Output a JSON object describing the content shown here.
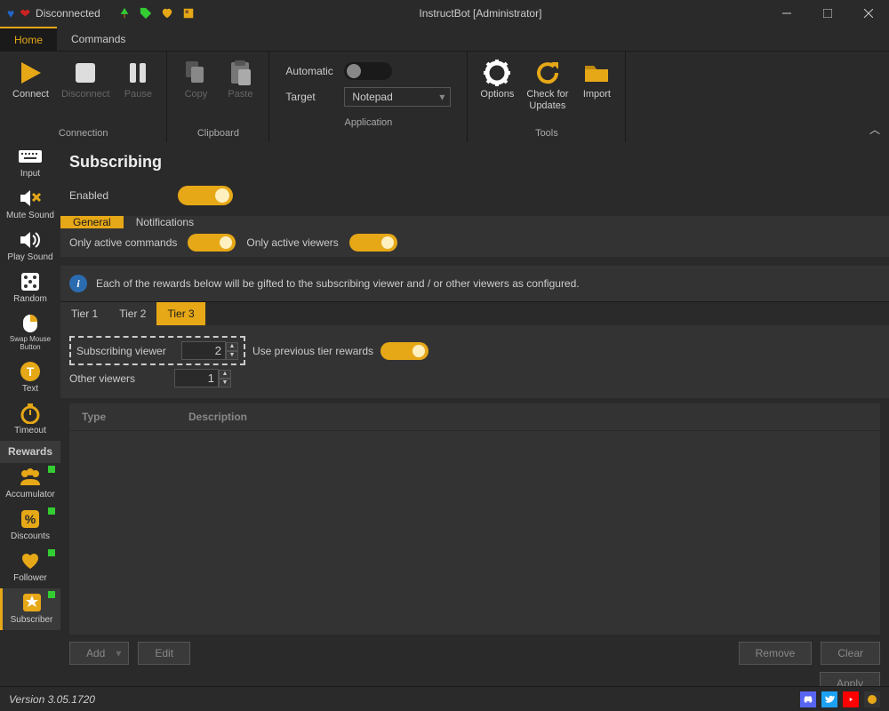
{
  "window": {
    "title": "InstructBot [Administrator]",
    "connection_status": "Disconnected"
  },
  "menu": {
    "home": "Home",
    "commands": "Commands"
  },
  "ribbon": {
    "connection": {
      "label": "Connection",
      "connect": "Connect",
      "disconnect": "Disconnect",
      "pause": "Pause"
    },
    "clipboard": {
      "label": "Clipboard",
      "copy": "Copy",
      "paste": "Paste"
    },
    "application": {
      "label": "Application",
      "automatic": "Automatic",
      "target": "Target",
      "target_value": "Notepad"
    },
    "tools": {
      "label": "Tools",
      "options": "Options",
      "check": "Check for\nUpdates",
      "import": "Import"
    }
  },
  "sidebar": {
    "items": [
      {
        "label": "Input",
        "icon": "input"
      },
      {
        "label": "Mute Sound",
        "icon": "mute"
      },
      {
        "label": "Play Sound",
        "icon": "play"
      },
      {
        "label": "Random",
        "icon": "dice"
      },
      {
        "label": "Swap Mouse Button",
        "icon": "mouse"
      },
      {
        "label": "Text",
        "icon": "text"
      },
      {
        "label": "Timeout",
        "icon": "clock"
      }
    ],
    "rewards_header": "Rewards",
    "rewards": [
      {
        "label": "Accumulator",
        "dot": true
      },
      {
        "label": "Discounts",
        "dot": true
      },
      {
        "label": "Follower",
        "dot": true
      },
      {
        "label": "Subscriber",
        "dot": true,
        "active": true
      }
    ]
  },
  "page": {
    "title": "Subscribing",
    "enabled_label": "Enabled",
    "subtabs": {
      "general": "General",
      "notifications": "Notifications"
    },
    "only_active_commands": "Only active commands",
    "only_active_viewers": "Only active viewers",
    "info_text": "Each of the rewards below will be gifted to the subscribing viewer and / or other viewers as configured.",
    "tier_tabs": [
      "Tier 1",
      "Tier 2",
      "Tier 3"
    ],
    "form": {
      "subscribing_viewer": "Subscribing viewer",
      "subscribing_viewer_value": "2",
      "use_previous": "Use previous tier rewards",
      "other_viewers": "Other viewers",
      "other_viewers_value": "1"
    },
    "table": {
      "type": "Type",
      "description": "Description"
    },
    "buttons": {
      "add": "Add",
      "edit": "Edit",
      "remove": "Remove",
      "clear": "Clear",
      "apply": "Apply"
    }
  },
  "status": {
    "version": "Version 3.05.1720"
  }
}
